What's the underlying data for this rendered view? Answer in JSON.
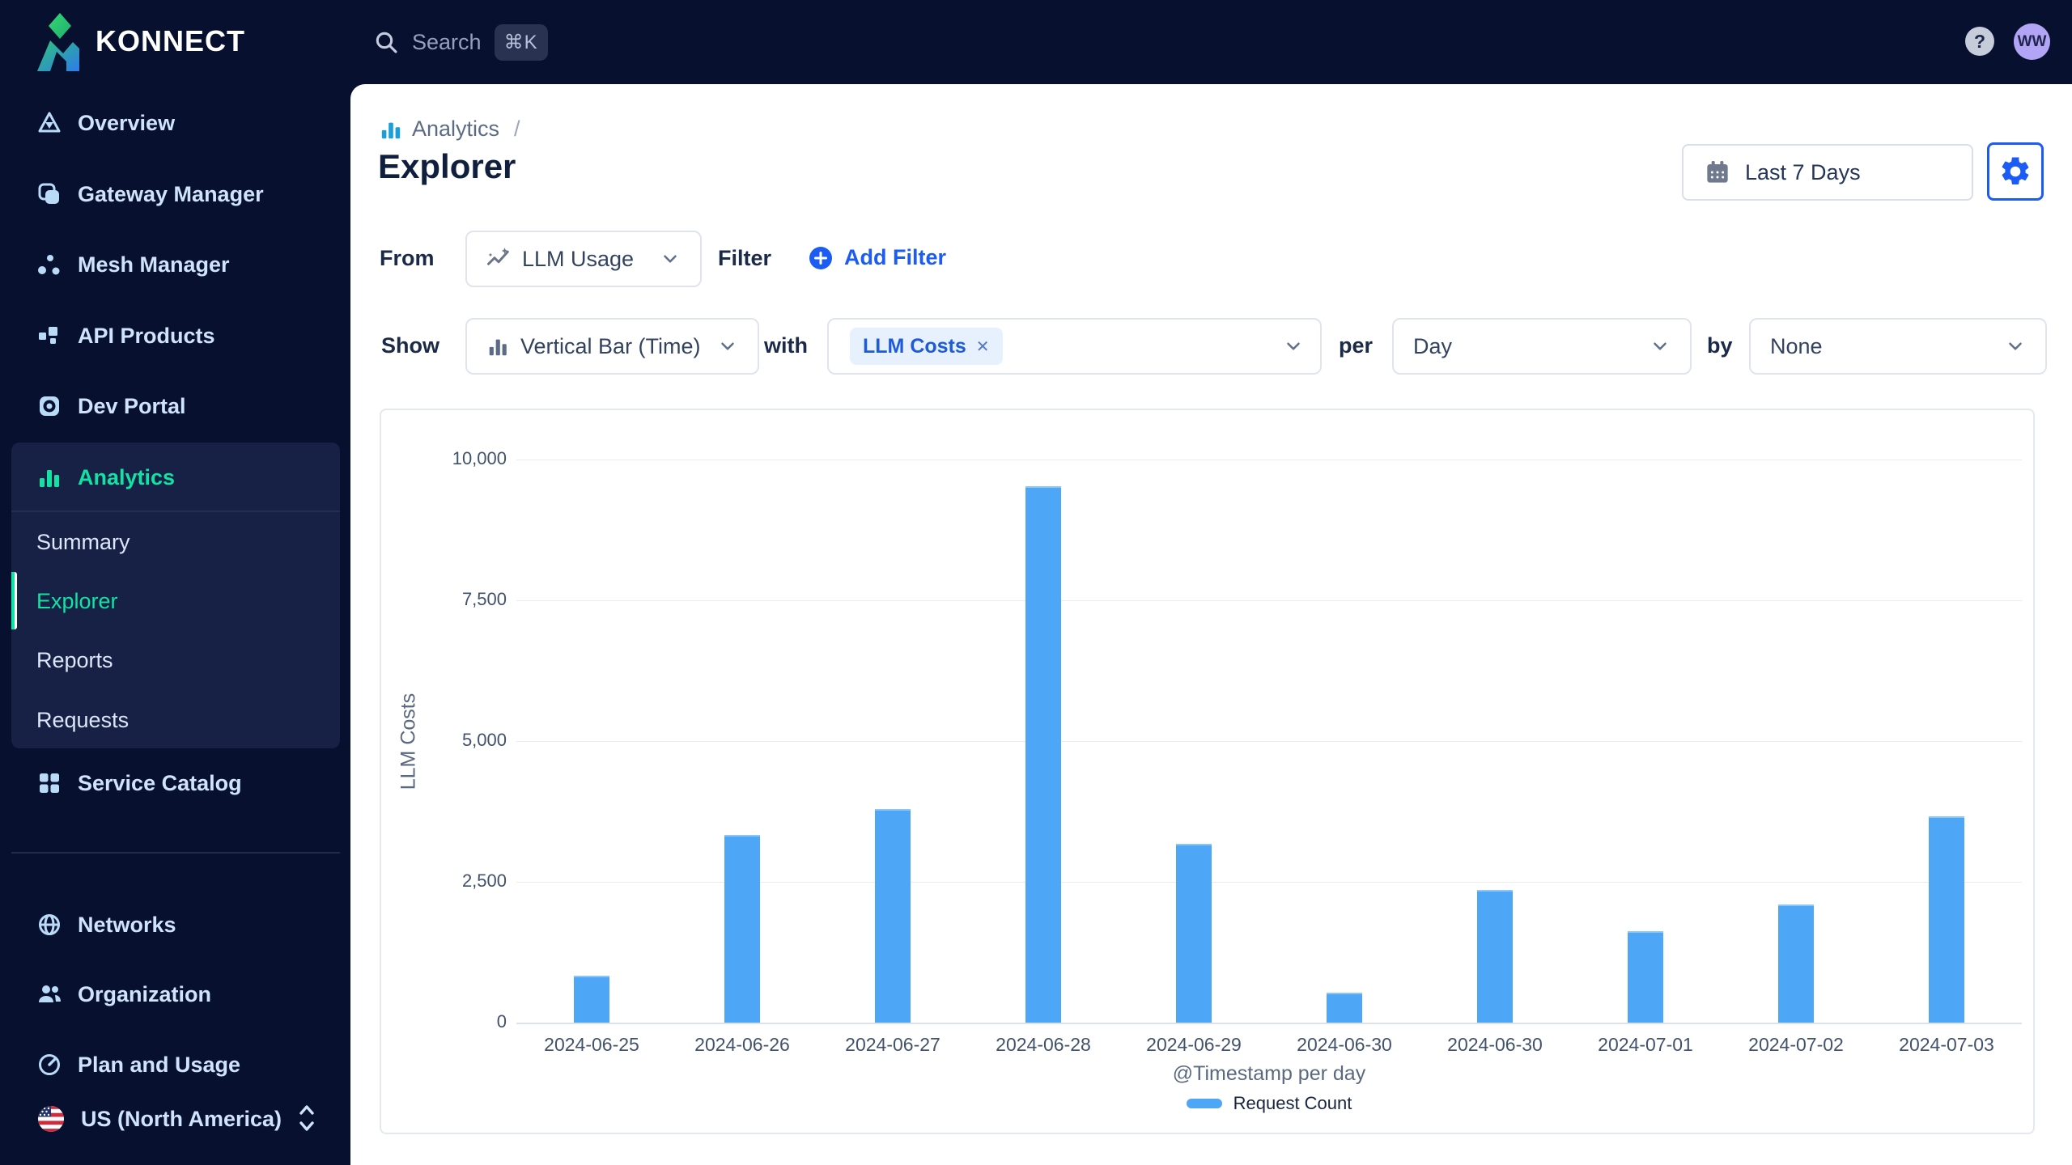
{
  "topbar": {
    "brand": "KONNECT",
    "search_label": "Search",
    "search_shortcut": "⌘K",
    "help_label": "?",
    "avatar_initials": "WW"
  },
  "sidebar": {
    "items": [
      "Overview",
      "Gateway Manager",
      "Mesh Manager",
      "API Products",
      "Dev Portal"
    ],
    "analytics": {
      "label": "Analytics",
      "subitems": [
        "Summary",
        "Explorer",
        "Reports",
        "Requests"
      ],
      "active_subitem": "Explorer"
    },
    "service_catalog": "Service Catalog",
    "bottom_items": [
      "Networks",
      "Organization",
      "Plan and Usage"
    ],
    "region_label": "US (North America)"
  },
  "header": {
    "breadcrumb": "Analytics",
    "breadcrumb_separator": "/",
    "title": "Explorer",
    "date_range": "Last 7 Days"
  },
  "query_builder": {
    "from_label": "From",
    "from_value": "LLM Usage",
    "filter_label": "Filter",
    "add_filter_label": "Add Filter",
    "show_label": "Show",
    "show_value": "Vertical Bar (Time)",
    "with_label": "with",
    "metric_chip": "LLM Costs",
    "metric_remove": "✕",
    "per_label": "per",
    "per_value": "Day",
    "by_label": "by",
    "by_value": "None"
  },
  "chart_data": {
    "type": "bar",
    "title": "",
    "categories": [
      "2024-06-25",
      "2024-06-26",
      "2024-06-27",
      "2024-06-28",
      "2024-06-29",
      "2024-06-30",
      "2024-06-30",
      "2024-07-01",
      "2024-07-02",
      "2024-07-03"
    ],
    "values": [
      830,
      3330,
      3790,
      9530,
      3170,
      530,
      2360,
      1620,
      2100,
      3660
    ],
    "series_name": "Request Count",
    "xlabel": "@Timestamp per day",
    "ylabel": "LLM Costs",
    "yticks": [
      "10,000",
      "7,500",
      "5,000",
      "2,500",
      "0"
    ],
    "ylim": [
      0,
      10000
    ],
    "grid": true,
    "legend_position": "bottom",
    "bar_color": "#4da6f6"
  },
  "colors": {
    "accent_blue": "#1d5bf5",
    "brand_teal": "#10e3a2",
    "bar_blue": "#4da6f6",
    "sidebar_bg": "#081030",
    "breadcrumb_icon_blue": "#1a9fd9"
  },
  "icons": {
    "search-icon": "magnifier",
    "command-key": "⌘",
    "help-icon": "?",
    "calendar-icon": "calendar",
    "gear-icon": "settings cog",
    "add-icon": "+ in circle",
    "close-icon": "✕",
    "chevron-down-icon": "v",
    "sparkle-trend-icon": "trend line with sparkles",
    "bar-chart-icon": "three vertical bars"
  }
}
